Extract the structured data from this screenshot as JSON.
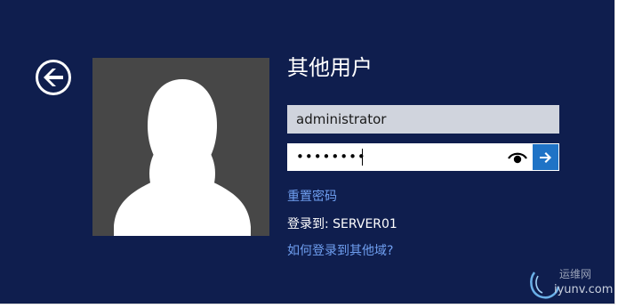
{
  "login": {
    "title": "其他用户",
    "username_value": "administrator",
    "password_masked": "••••••••",
    "reset_password_label": "重置密码",
    "signin_to_label": "登录到: SERVER01",
    "other_domain_label": "如何登录到其他域?"
  },
  "watermark": {
    "line1": "运维网",
    "line2": "iyunv.com"
  },
  "icons": {
    "back": "back-arrow-icon",
    "reveal": "eye-icon",
    "submit": "arrow-right-icon",
    "avatar": "user-silhouette"
  },
  "colors": {
    "background": "#0f1e4e",
    "link": "#6f9ff0",
    "submit": "#1f73c6",
    "avatar_tile": "#474747",
    "username_field": "#d0d4dd"
  }
}
